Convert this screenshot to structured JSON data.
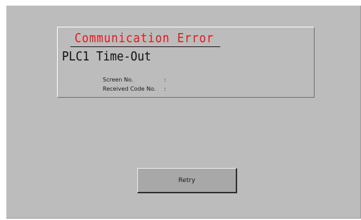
{
  "error_panel": {
    "title": "Communication Error",
    "message": "PLC1 Time-Out",
    "details": [
      {
        "label": "Screen No.",
        "value": ":"
      },
      {
        "label": "Received Code No.",
        "value": ":"
      }
    ]
  },
  "retry_button": {
    "label": "Retry"
  },
  "colors": {
    "screen_background": "#bcbcbc",
    "title_text": "#e8141e",
    "button_face": "#a8a8a8"
  }
}
